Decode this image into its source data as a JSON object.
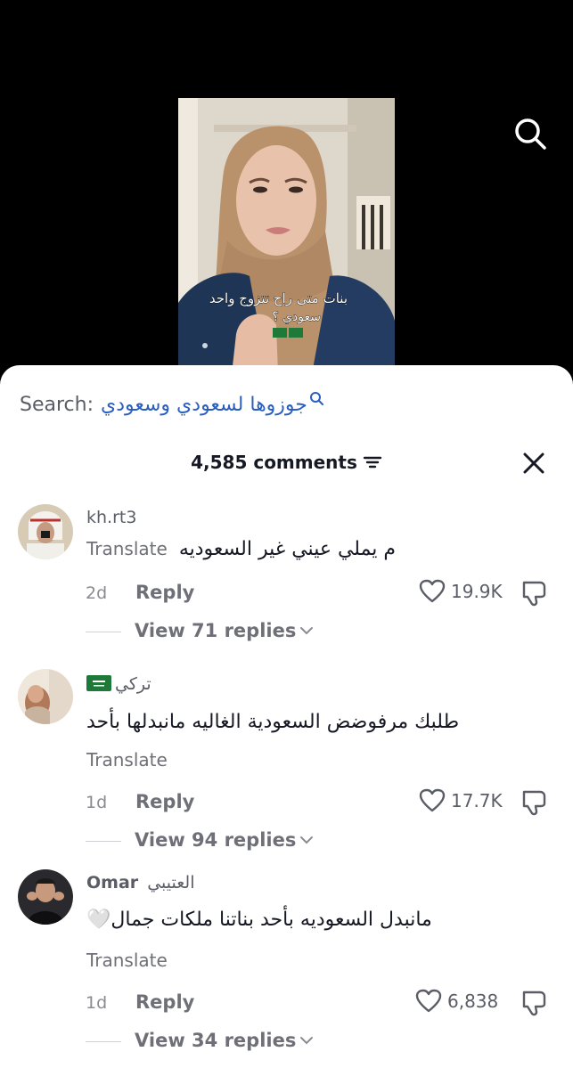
{
  "video": {
    "caption_line1": "بنات متى راح تتزوج واحد",
    "caption_line2": "سعودي ؟"
  },
  "comments_panel": {
    "search_label": "Search:",
    "search_query": "جوزوها لسعودي وسعودي",
    "comment_count": "4,585 comments",
    "comments": [
      {
        "username": "kh.rt3",
        "text": "م يملي عيني غير السعوديه",
        "translate": "Translate",
        "date": "2d",
        "reply": "Reply",
        "likes": "19.9K",
        "view_replies": "View 71 replies"
      },
      {
        "username": "تركي",
        "text": "طلبك مرفوضض السعودية الغاليه مانبدلها بأحد",
        "translate": "Translate",
        "date": "1d",
        "reply": "Reply",
        "likes": "17.7K",
        "view_replies": "View 94 replies"
      },
      {
        "username_latin": "Omar",
        "username_arabic": "العتيبي",
        "text": "مانبدل السعوديه بأحد بناتنا ملكات جمال🤍",
        "translate": "Translate",
        "date": "1d",
        "reply": "Reply",
        "likes": "6,838",
        "view_replies": "View 34 replies"
      }
    ]
  },
  "colors": {
    "background_top": "#000000",
    "sheet": "#ffffff",
    "search_query": "#2b5fbf",
    "secondary_text": "#6f7077",
    "flag_green": "#1f7a3a"
  },
  "icons": [
    "search-icon",
    "filter-icon",
    "close-icon",
    "heart-icon",
    "dislike-icon",
    "chevron-down-icon"
  ]
}
